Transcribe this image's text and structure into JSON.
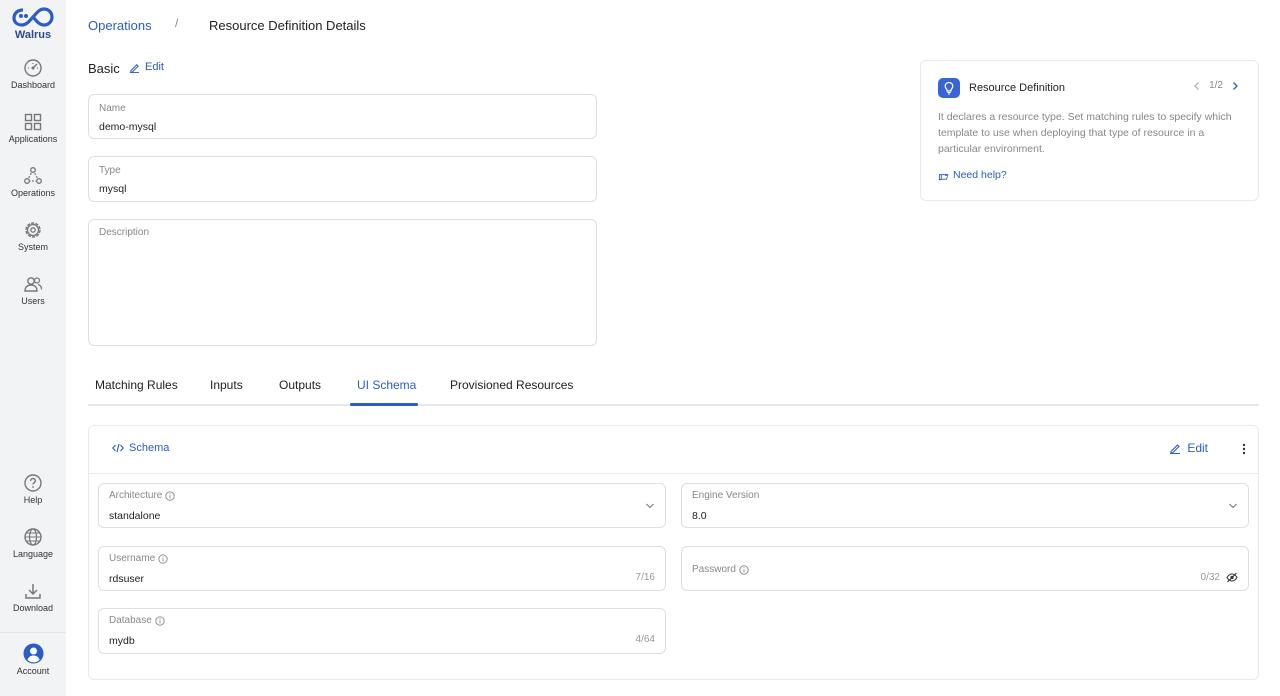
{
  "brand": {
    "name": "Walrus"
  },
  "sidebar": {
    "items": [
      {
        "label": "Dashboard"
      },
      {
        "label": "Applications"
      },
      {
        "label": "Operations"
      },
      {
        "label": "System"
      },
      {
        "label": "Users"
      }
    ],
    "bottom_items": [
      {
        "label": "Help"
      },
      {
        "label": "Language"
      },
      {
        "label": "Download"
      },
      {
        "label": "Account"
      }
    ]
  },
  "breadcrumb": {
    "parent": "Operations",
    "separator": "/",
    "current": "Resource Definition Details"
  },
  "basic": {
    "title": "Basic",
    "edit_label": "Edit",
    "fields": {
      "name": {
        "label": "Name",
        "value": "demo-mysql"
      },
      "type": {
        "label": "Type",
        "value": "mysql"
      },
      "description": {
        "label": "Description",
        "value": ""
      }
    }
  },
  "info_card": {
    "title": "Resource Definition",
    "pager": "1/2",
    "description": "It declares a resource type. Set matching rules to specify which template to use when deploying that type of resource in a particular environment.",
    "help_label": "Need help?",
    "accent": "#3a64d6"
  },
  "tabs": [
    {
      "label": "Matching Rules",
      "active": false
    },
    {
      "label": "Inputs",
      "active": false
    },
    {
      "label": "Outputs",
      "active": false
    },
    {
      "label": "UI Schema",
      "active": true
    },
    {
      "label": "Provisioned Resources",
      "active": false
    }
  ],
  "schema_panel": {
    "schema_label": "Schema",
    "edit_label": "Edit",
    "fields": {
      "architecture": {
        "label": "Architecture",
        "value": "standalone"
      },
      "engine_version": {
        "label": "Engine Version",
        "value": "8.0"
      },
      "username": {
        "label": "Username",
        "value": "rdsuser",
        "count": "7/16"
      },
      "password": {
        "label": "Password",
        "value": "",
        "count": "0/32"
      },
      "database": {
        "label": "Database",
        "value": "mydb",
        "count": "4/64"
      }
    }
  },
  "colors": {
    "primary": "#2c5cc5",
    "sidebar_bg": "#f2f3f5"
  }
}
